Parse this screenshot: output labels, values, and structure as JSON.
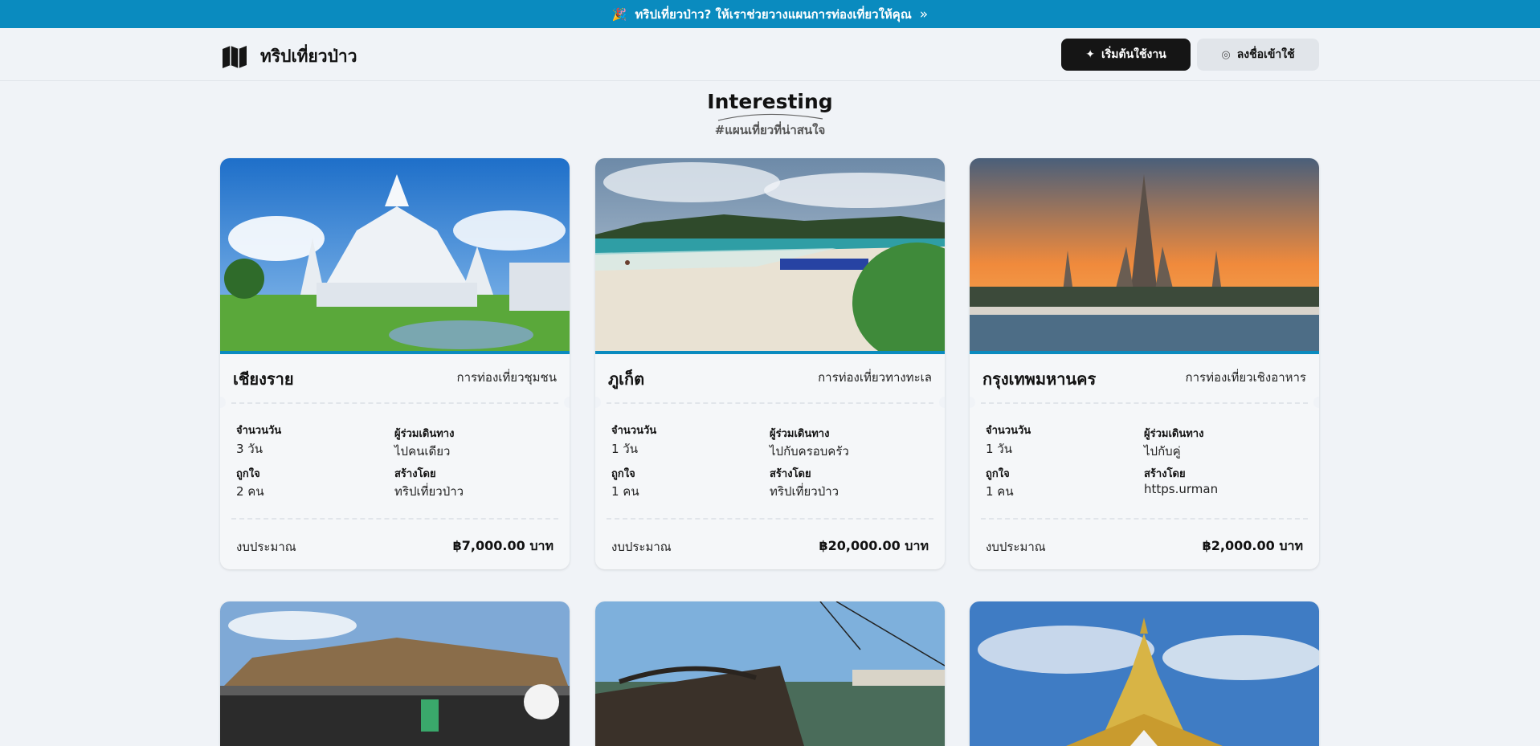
{
  "banner": {
    "text": "ทริปเที่ยวป่าว? ให้เราช่วยวางแผนการท่องเที่ยวให้คุณ",
    "emoji": "🎉",
    "arrow": "»"
  },
  "header": {
    "brand": "ทริปเที่ยวป่าว",
    "start_button": "เริ่มต้นใช้งาน",
    "login_button": "ลงชื่อเข้าใช้"
  },
  "section": {
    "title": "Interesting",
    "subtitle": "#แผนเที่ยวที่น่าสนใจ"
  },
  "labels": {
    "days": "จำนวนวัน",
    "companions": "ผู้ร่วมเดินทาง",
    "likes": "ถูกใจ",
    "creator": "สร้างโดย",
    "budget": "งบประมาณ"
  },
  "cards": [
    {
      "name": "เชียงราย",
      "type": "การท่องเที่ยวชุมชน",
      "days": "3 วัน",
      "companions": "ไปคนเดียว",
      "likes": "2 คน",
      "creator": "ทริปเที่ยวป่าว",
      "budget": "฿7,000.00 บาท",
      "image": "white-temple"
    },
    {
      "name": "ภูเก็ต",
      "type": "การท่องเที่ยวทางทะเล",
      "days": "1 วัน",
      "companions": "ไปกับครอบครัว",
      "likes": "1 คน",
      "creator": "ทริปเที่ยวป่าว",
      "budget": "฿20,000.00 บาท",
      "image": "beach"
    },
    {
      "name": "กรุงเทพมหานคร",
      "type": "การท่องเที่ยวเชิงอาหาร",
      "days": "1 วัน",
      "companions": "ไปกับคู่",
      "likes": "1 คน",
      "creator": "https.urman",
      "budget": "฿2,000.00 บาท",
      "image": "wat-arun"
    },
    {
      "image": "market"
    },
    {
      "image": "bridge"
    },
    {
      "image": "golden-pagoda"
    }
  ],
  "colors": {
    "accent": "#0a8bbf",
    "dark_button": "#151515",
    "background": "#f0f3f7"
  }
}
